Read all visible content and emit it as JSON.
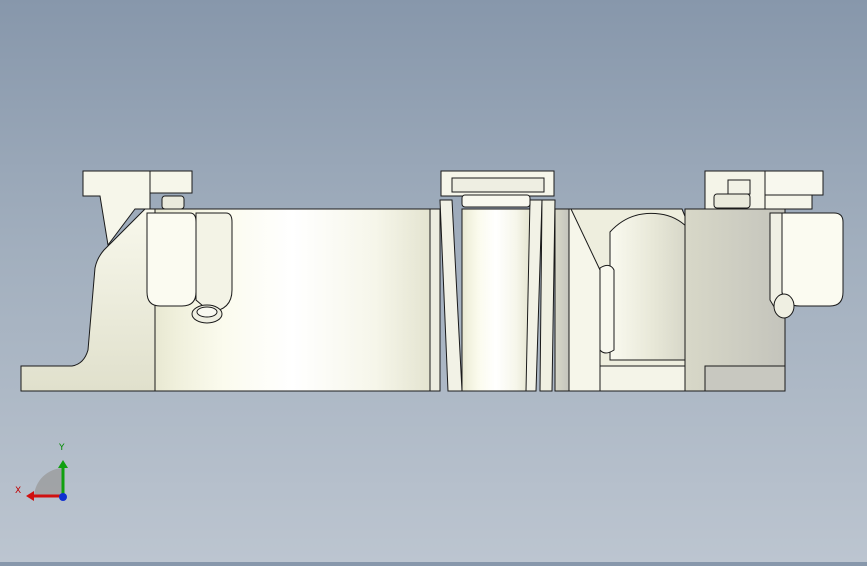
{
  "viewport": {
    "background_top": "#8797ab",
    "background_bottom": "#bcc5d0",
    "part_face_color": "#f4f4e4",
    "part_shadow_color": "#c9c9bd",
    "edge_color": "#1a1a1a"
  },
  "triad": {
    "x_label": "X",
    "y_label": "Y",
    "x_color": "#d01010",
    "y_color": "#10a010",
    "z_color": "#1030d0"
  }
}
